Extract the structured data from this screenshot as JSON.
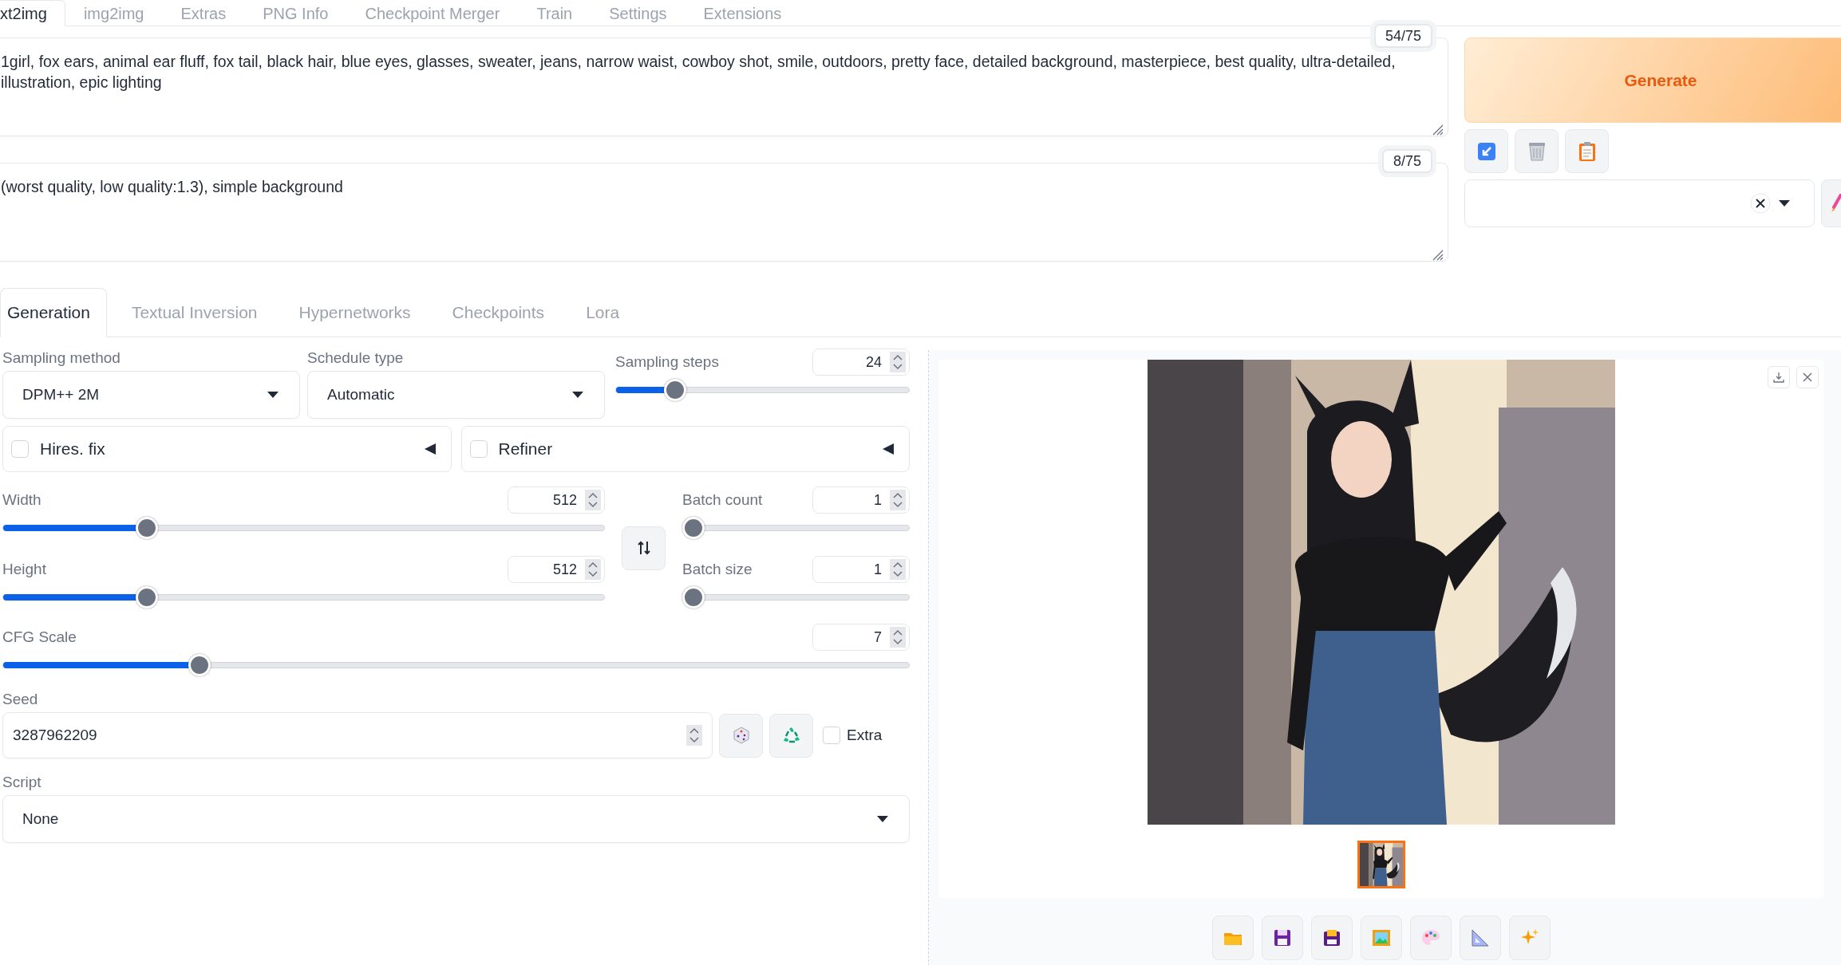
{
  "top_tabs": [
    {
      "label": "xt2img",
      "selected": true
    },
    {
      "label": "img2img",
      "selected": false
    },
    {
      "label": "Extras",
      "selected": false
    },
    {
      "label": "PNG Info",
      "selected": false
    },
    {
      "label": "Checkpoint Merger",
      "selected": false
    },
    {
      "label": "Train",
      "selected": false
    },
    {
      "label": "Settings",
      "selected": false
    },
    {
      "label": "Extensions",
      "selected": false
    }
  ],
  "prompt": {
    "value": "1girl, fox ears, animal ear fluff, fox tail, black hair, blue eyes, glasses, sweater, jeans, narrow waist, cowboy shot, smile, outdoors, pretty face, detailed background, masterpiece, best quality, ultra-detailed, illustration, epic lighting",
    "token_count": "54/75"
  },
  "negative_prompt": {
    "value": "(worst quality, low quality:1.3), simple background",
    "token_count": "8/75"
  },
  "generate_button": "Generate",
  "settings_tabs": [
    {
      "label": "Generation",
      "selected": true
    },
    {
      "label": "Textual Inversion",
      "selected": false
    },
    {
      "label": "Hypernetworks",
      "selected": false
    },
    {
      "label": "Checkpoints",
      "selected": false
    },
    {
      "label": "Lora",
      "selected": false
    }
  ],
  "sampling_method": {
    "label": "Sampling method",
    "value": "DPM++ 2M"
  },
  "schedule_type": {
    "label": "Schedule type",
    "value": "Automatic"
  },
  "sampling_steps": {
    "label": "Sampling steps",
    "value": "24",
    "level": 0.18
  },
  "accordions": [
    {
      "label": "Hires. fix",
      "checked": false,
      "expanded": false
    },
    {
      "label": "Refiner",
      "checked": false,
      "expanded": false
    }
  ],
  "width": {
    "label": "Width",
    "value": "512",
    "level": 0.23
  },
  "height": {
    "label": "Height",
    "value": "512",
    "level": 0.23
  },
  "batch_count": {
    "label": "Batch count",
    "value": "1",
    "level": 0
  },
  "batch_size": {
    "label": "Batch size",
    "value": "1",
    "level": 0
  },
  "cfg_scale": {
    "label": "CFG Scale",
    "value": "7",
    "level": 0.21
  },
  "seed": {
    "label": "Seed",
    "value": "3287962209"
  },
  "extra": {
    "label": "Extra",
    "checked": false
  },
  "script": {
    "label": "Script",
    "value": "None"
  },
  "gallery": {
    "thumbnails": [
      {
        "selected": true
      }
    ]
  }
}
